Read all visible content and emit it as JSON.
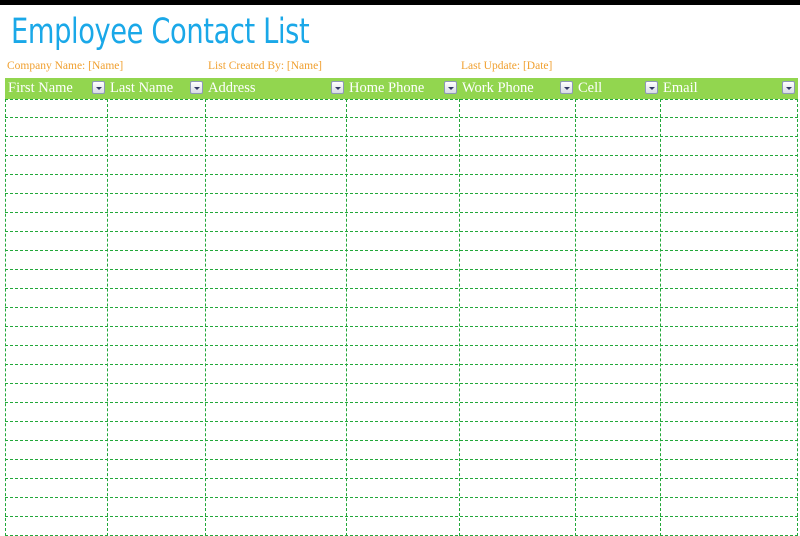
{
  "title": "Employee Contact List",
  "meta": {
    "company": "Company Name: [Name]",
    "created_by": "List Created By: [Name]",
    "last_update": "Last Update: [Date]"
  },
  "colors": {
    "title": "#1aa8e8",
    "meta_text": "#f0a030",
    "header_bg": "#92d64f",
    "grid_line": "#22a83a"
  },
  "table": {
    "columns": [
      {
        "label": "First Name",
        "filter_icon": "dropdown-arrow-icon"
      },
      {
        "label": "Last Name",
        "filter_icon": "dropdown-arrow-icon"
      },
      {
        "label": "Address",
        "filter_icon": "dropdown-arrow-icon"
      },
      {
        "label": "Home Phone",
        "filter_icon": "dropdown-arrow-icon"
      },
      {
        "label": "Work Phone",
        "filter_icon": "dropdown-arrow-icon"
      },
      {
        "label": "Cell",
        "filter_icon": "dropdown-arrow-icon"
      },
      {
        "label": "Email",
        "filter_icon": "dropdown-arrow-icon"
      }
    ],
    "row_count": 23,
    "rows": []
  }
}
